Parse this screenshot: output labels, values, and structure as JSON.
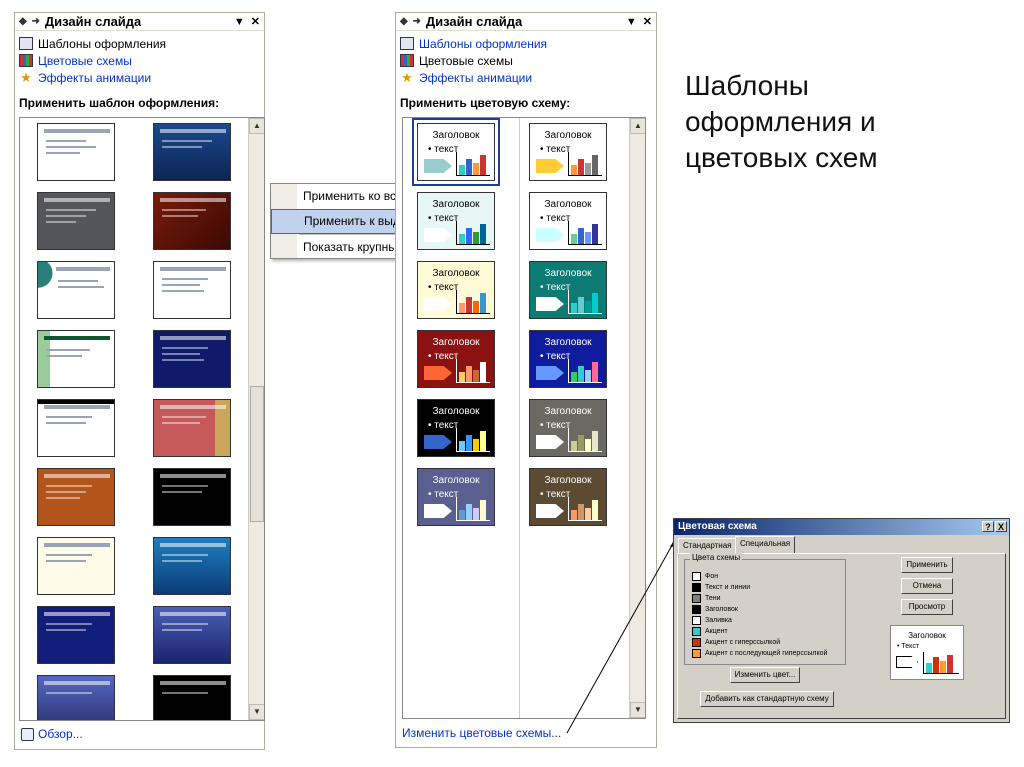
{
  "left_pane": {
    "title": "Дизайн слайда",
    "nav_glyphs": "◆ ➜",
    "menu_glyph": "▼",
    "close_glyph": "✕",
    "links": [
      {
        "label": "Шаблоны оформления",
        "icon": "template-icon"
      },
      {
        "label": "Цветовые схемы",
        "icon": "color-scheme-icon"
      },
      {
        "label": "Эффекты анимации",
        "icon": "animation-star-icon"
      }
    ],
    "apply_label": "Применить шаблон оформления:",
    "footer_link": "Обзор..."
  },
  "context_menu": {
    "items": [
      "Применить ко всем слайдам",
      "Применить к выделенным слайдам",
      "Показать крупные эскизы"
    ],
    "highlighted_index": 1
  },
  "right_pane": {
    "title": "Дизайн слайда",
    "links": [
      {
        "label": "Шаблоны оформления",
        "icon": "template-icon"
      },
      {
        "label": "Цветовые схемы",
        "icon": "color-scheme-icon"
      },
      {
        "label": "Эффекты анимации",
        "icon": "animation-star-icon"
      }
    ],
    "apply_label": "Применить цветовую схему:",
    "scheme_heading": "Заголовок",
    "scheme_text": "• текст",
    "footer_link": "Изменить цветовые схемы..."
  },
  "slide_title": {
    "line1": "Шаблоны",
    "line2": "оформления и",
    "line3": "цветовых схем"
  },
  "dialog": {
    "title": "Цветовая схема",
    "help_glyph": "?",
    "close_glyph": "X",
    "tabs": [
      "Стандартная",
      "Специальная"
    ],
    "group_label": "Цвета схемы",
    "colors": [
      {
        "label": "Фон",
        "color": "#ffffff"
      },
      {
        "label": "Текст и линии",
        "color": "#000000"
      },
      {
        "label": "Тени",
        "color": "#808080"
      },
      {
        "label": "Заголовок",
        "color": "#000000"
      },
      {
        "label": "Заливка",
        "color": "#ffffff"
      },
      {
        "label": "Акцент",
        "color": "#33cccc"
      },
      {
        "label": "Акцент с гиперссылкой",
        "color": "#cc3300"
      },
      {
        "label": "Акцент с последующей гиперссылкой",
        "color": "#ff9933"
      }
    ],
    "change_color_button": "Изменить цвет...",
    "add_standard_button": "Добавить как стандартную схему",
    "apply_button": "Применить",
    "cancel_button": "Отмена",
    "preview_button": "Просмотр",
    "preview_heading": "Заголовок",
    "preview_text": "• Текст"
  },
  "colors": {
    "link_blue": "#0033cc",
    "menu_highlight": "#c1d2ee",
    "dialog_face": "#d4d0c8"
  }
}
